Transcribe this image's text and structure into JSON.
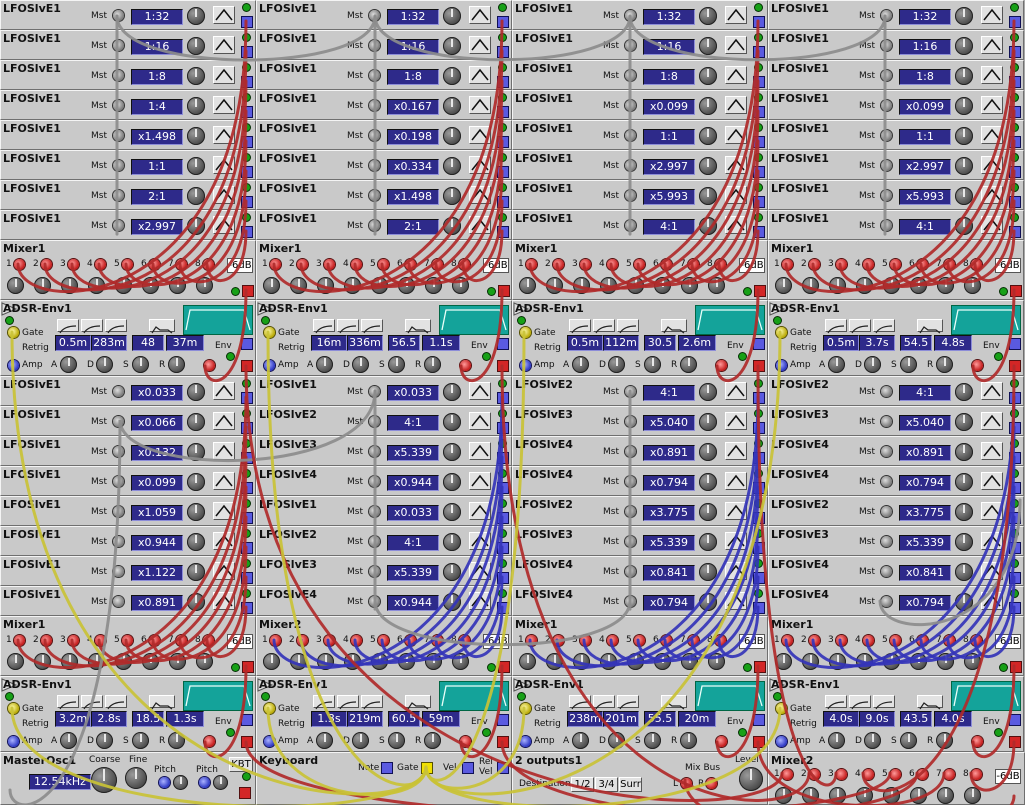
{
  "colors": {
    "panel": "#c9c9c9",
    "lcd": "#2e2a8a",
    "cable_red": "#b02a2a",
    "cable_blue": "#3434b8",
    "cable_gray": "#8c8c8c",
    "cable_yellow": "#c9c236",
    "scope": "#14a39a"
  },
  "labels": {
    "mst": "Mst",
    "gate": "Gate",
    "retrig": "Retrig",
    "amp": "Amp",
    "env": "Env",
    "a": "A",
    "d": "D",
    "s": "S",
    "r": "R",
    "db": "-6dB",
    "coarse": "Coarse",
    "fine": "Fine",
    "pitch": "Pitch",
    "kbt": "KBT",
    "note": "Note",
    "gate_kb": "Gate",
    "vel": "Vel",
    "rel_vel": "Rel\nVel",
    "destination": "Destination",
    "dest_options": [
      "1/2",
      "3/4",
      "Surr"
    ],
    "mix_bus": "Mix Bus",
    "level": "Level",
    "mix_l": "L",
    "mix_r": "R"
  },
  "lfo_groups": [
    [
      [
        {
          "name": "LFOSlvE1",
          "rate": "1:32"
        },
        {
          "name": "LFOSlvE1",
          "rate": "1:16"
        },
        {
          "name": "LFOSlvE1",
          "rate": "1:8"
        },
        {
          "name": "LFOSlvE1",
          "rate": "1:4"
        },
        {
          "name": "LFOSlvE1",
          "rate": "x1.498"
        },
        {
          "name": "LFOSlvE1",
          "rate": "1:1"
        },
        {
          "name": "LFOSlvE1",
          "rate": "2:1"
        },
        {
          "name": "LFOSlvE1",
          "rate": "x2.997"
        }
      ],
      [
        {
          "name": "LFOSlvE1",
          "rate": "1:32"
        },
        {
          "name": "LFOSlvE1",
          "rate": "1:16"
        },
        {
          "name": "LFOSlvE1",
          "rate": "1:8"
        },
        {
          "name": "LFOSlvE1",
          "rate": "x0.167"
        },
        {
          "name": "LFOSlvE1",
          "rate": "x0.198"
        },
        {
          "name": "LFOSlvE1",
          "rate": "x0.334"
        },
        {
          "name": "LFOSlvE1",
          "rate": "x1.498"
        },
        {
          "name": "LFOSlvE1",
          "rate": "2:1"
        }
      ],
      [
        {
          "name": "LFOSlvE1",
          "rate": "1:32"
        },
        {
          "name": "LFOSlvE1",
          "rate": "1:16"
        },
        {
          "name": "LFOSlvE1",
          "rate": "1:8"
        },
        {
          "name": "LFOSlvE1",
          "rate": "x0.099"
        },
        {
          "name": "LFOSlvE1",
          "rate": "1:1"
        },
        {
          "name": "LFOSlvE1",
          "rate": "x2.997"
        },
        {
          "name": "LFOSlvE1",
          "rate": "x5.993"
        },
        {
          "name": "LFOSlvE1",
          "rate": "4:1"
        }
      ],
      [
        {
          "name": "LFOSlvE1",
          "rate": "1:32"
        },
        {
          "name": "LFOSlvE1",
          "rate": "1:16"
        },
        {
          "name": "LFOSlvE1",
          "rate": "1:8"
        },
        {
          "name": "LFOSlvE1",
          "rate": "x0.099"
        },
        {
          "name": "LFOSlvE1",
          "rate": "1:1"
        },
        {
          "name": "LFOSlvE1",
          "rate": "x2.997"
        },
        {
          "name": "LFOSlvE1",
          "rate": "x5.993"
        },
        {
          "name": "LFOSlvE1",
          "rate": "4:1"
        }
      ]
    ],
    [
      [
        {
          "name": "LFOSlvE1",
          "rate": "x0.033"
        },
        {
          "name": "LFOSlvE1",
          "rate": "x0.066"
        },
        {
          "name": "LFOSlvE1",
          "rate": "x0.132"
        },
        {
          "name": "LFOSlvE1",
          "rate": "x0.099"
        },
        {
          "name": "LFOSlvE1",
          "rate": "x1.059"
        },
        {
          "name": "LFOSlvE1",
          "rate": "x0.944"
        },
        {
          "name": "LFOSlvE1",
          "rate": "x1.122"
        },
        {
          "name": "LFOSlvE1",
          "rate": "x0.891"
        }
      ],
      [
        {
          "name": "LFOSlvE1",
          "rate": "x0.033"
        },
        {
          "name": "LFOSlvE2",
          "rate": "4:1"
        },
        {
          "name": "LFOSlvE3",
          "rate": "x5.339"
        },
        {
          "name": "LFOSlvE4",
          "rate": "x0.944"
        },
        {
          "name": "LFOSlvE1",
          "rate": "x0.033"
        },
        {
          "name": "LFOSlvE2",
          "rate": "4:1"
        },
        {
          "name": "LFOSlvE3",
          "rate": "x5.339"
        },
        {
          "name": "LFOSlvE4",
          "rate": "x0.944"
        }
      ],
      [
        {
          "name": "LFOSlvE2",
          "rate": "4:1"
        },
        {
          "name": "LFOSlvE3",
          "rate": "x5.040"
        },
        {
          "name": "LFOSlvE4",
          "rate": "x0.891"
        },
        {
          "name": "LFOSlvE4",
          "rate": "x0.794"
        },
        {
          "name": "LFOSlvE2",
          "rate": "x3.775"
        },
        {
          "name": "LFOSlvE3",
          "rate": "x5.339"
        },
        {
          "name": "LFOSlvE4",
          "rate": "x0.841"
        },
        {
          "name": "LFOSlvE4",
          "rate": "x0.794"
        }
      ],
      [
        {
          "name": "LFOSlvE2",
          "rate": "4:1"
        },
        {
          "name": "LFOSlvE3",
          "rate": "x5.040"
        },
        {
          "name": "LFOSlvE4",
          "rate": "x0.891"
        },
        {
          "name": "LFOSlvE4",
          "rate": "x0.794"
        },
        {
          "name": "LFOSlvE2",
          "rate": "x3.775"
        },
        {
          "name": "LFOSlvE3",
          "rate": "x5.339"
        },
        {
          "name": "LFOSlvE4",
          "rate": "x0.841"
        },
        {
          "name": "LFOSlvE4",
          "rate": "x0.794"
        }
      ]
    ]
  ],
  "mixers": [
    [
      "Mixer1",
      "Mixer1",
      "Mixer1",
      "Mixer1"
    ],
    [
      "Mixer1",
      "Mixer2",
      "Mixer1",
      "Mixer1"
    ]
  ],
  "mixer_channels": [
    "1",
    "2",
    "3",
    "4",
    "5",
    "6",
    "7",
    "8"
  ],
  "adsr": [
    [
      {
        "name": "ADSR-Env1",
        "a": "0.5m",
        "d": "283m",
        "s": "48",
        "r": "37m"
      },
      {
        "name": "ADSR-Env1",
        "a": "16m",
        "d": "336m",
        "s": "56.5",
        "r": "1.1s"
      },
      {
        "name": "ADSR-Env1",
        "a": "0.5m",
        "d": "112m",
        "s": "30.5",
        "r": "2.6m"
      },
      {
        "name": "ADSR-Env1",
        "a": "0.5m",
        "d": "3.7s",
        "s": "54.5",
        "r": "4.8s"
      }
    ],
    [
      {
        "name": "ADSR-Env1",
        "a": "3.2m",
        "d": "2.8s",
        "s": "18.5",
        "r": "1.3s"
      },
      {
        "name": "ADSR-Env1",
        "a": "1.3s",
        "d": "219m",
        "s": "60.5",
        "r": "59m"
      },
      {
        "name": "ADSR-Env1",
        "a": "238m",
        "d": "201m",
        "s": "55.5",
        "r": "20m"
      },
      {
        "name": "ADSR-Env1",
        "a": "4.0s",
        "d": "9.0s",
        "s": "43.5",
        "r": "4.0s"
      }
    ]
  ],
  "master_osc": {
    "name": "MasterOsc1",
    "freq": "12.54kHz"
  },
  "keyboard": {
    "name": "Keyboard"
  },
  "outputs": {
    "name": "2 outputs1"
  },
  "mixer2": {
    "name": "Mixer2"
  }
}
